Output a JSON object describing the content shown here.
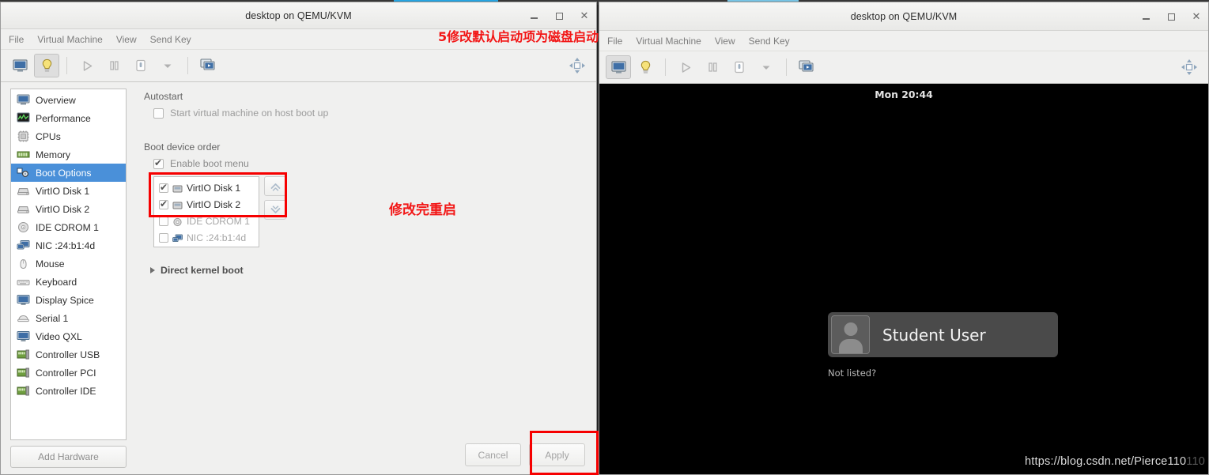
{
  "backdrop": {
    "desktop_bg": "#2b2b2b",
    "accent": "#29b0f0"
  },
  "annotations": {
    "top_note": "5修改默认启动项为磁盘启动",
    "middle_note": "修改完重启",
    "highlight_color": "#f60000"
  },
  "left_window": {
    "title": "desktop on QEMU/KVM",
    "window_buttons": {
      "minimize": "–",
      "maximize": "□",
      "close": "✕"
    },
    "menu": [
      "File",
      "Virtual Machine",
      "View",
      "Send Key"
    ],
    "toolbar": [
      {
        "name": "show-console-view",
        "icon": "monitor-icon",
        "pressed": false
      },
      {
        "name": "show-details-view",
        "icon": "lightbulb-icon",
        "pressed": true
      },
      {
        "name": "run-vm",
        "icon": "play-icon",
        "pressed": false
      },
      {
        "name": "pause-vm",
        "icon": "pause-icon",
        "pressed": false
      },
      {
        "name": "shutdown-vm",
        "icon": "power-icon",
        "pressed": false
      },
      {
        "name": "shutdown-options",
        "icon": "chevron-down-icon",
        "pressed": false
      },
      {
        "name": "snapshots",
        "icon": "snapshots-icon",
        "pressed": false
      },
      {
        "name": "fullscreen",
        "icon": "fullscreen-icon",
        "pressed": false
      }
    ],
    "hardware_list": [
      {
        "label": "Overview",
        "icon": "monitor-icon",
        "selected": false
      },
      {
        "label": "Performance",
        "icon": "graph-icon",
        "selected": false
      },
      {
        "label": "CPUs",
        "icon": "cpu-icon",
        "selected": false
      },
      {
        "label": "Memory",
        "icon": "memory-icon",
        "selected": false
      },
      {
        "label": "Boot Options",
        "icon": "boot-gear-icon",
        "selected": true
      },
      {
        "label": "VirtIO Disk 1",
        "icon": "disk-icon",
        "selected": false
      },
      {
        "label": "VirtIO Disk 2",
        "icon": "disk-icon",
        "selected": false
      },
      {
        "label": "IDE CDROM 1",
        "icon": "cdrom-icon",
        "selected": false
      },
      {
        "label": "NIC :24:b1:4d",
        "icon": "nic-icon",
        "selected": false
      },
      {
        "label": "Mouse",
        "icon": "mouse-icon",
        "selected": false
      },
      {
        "label": "Keyboard",
        "icon": "keyboard-icon",
        "selected": false
      },
      {
        "label": "Display Spice",
        "icon": "display-icon",
        "selected": false
      },
      {
        "label": "Serial 1",
        "icon": "serial-icon",
        "selected": false
      },
      {
        "label": "Video QXL",
        "icon": "video-icon",
        "selected": false
      },
      {
        "label": "Controller USB",
        "icon": "controller-icon",
        "selected": false
      },
      {
        "label": "Controller PCI",
        "icon": "controller-icon",
        "selected": false
      },
      {
        "label": "Controller IDE",
        "icon": "controller-icon",
        "selected": false
      }
    ],
    "add_hardware_label": "Add Hardware",
    "panel": {
      "autostart_title": "Autostart",
      "autostart_checkbox": {
        "label": "Start virtual machine on host boot up",
        "checked": false
      },
      "boot_order_title": "Boot device order",
      "boot_menu_checkbox": {
        "label": "Enable boot menu",
        "checked": true
      },
      "boot_devices": [
        {
          "label": "VirtIO Disk 1",
          "icon": "disk-icon",
          "checked": true
        },
        {
          "label": "VirtIO Disk 2",
          "icon": "disk-icon",
          "checked": true
        },
        {
          "label": "IDE CDROM 1",
          "icon": "cdrom-icon",
          "checked": false
        },
        {
          "label": "NIC :24:b1:4d",
          "icon": "nic-icon",
          "checked": false
        }
      ],
      "move_up_icon": "chevron-up-icon",
      "move_down_icon": "chevron-down-icon",
      "direct_kernel_boot": "Direct kernel boot"
    },
    "buttons": {
      "cancel": "Cancel",
      "apply": "Apply"
    }
  },
  "right_window": {
    "title": "desktop on QEMU/KVM",
    "window_buttons": {
      "minimize": "–",
      "maximize": "□",
      "close": "✕"
    },
    "menu": [
      "File",
      "Virtual Machine",
      "View",
      "Send Key"
    ],
    "toolbar": [
      {
        "name": "show-console-view",
        "icon": "monitor-icon",
        "pressed": true
      },
      {
        "name": "show-details-view",
        "icon": "lightbulb-icon",
        "pressed": false
      },
      {
        "name": "run-vm",
        "icon": "play-icon",
        "pressed": false
      },
      {
        "name": "pause-vm",
        "icon": "pause-icon",
        "pressed": false
      },
      {
        "name": "shutdown-vm",
        "icon": "power-icon",
        "pressed": false
      },
      {
        "name": "shutdown-options",
        "icon": "chevron-down-icon",
        "pressed": false
      },
      {
        "name": "snapshots",
        "icon": "snapshots-icon",
        "pressed": false
      },
      {
        "name": "fullscreen",
        "icon": "fullscreen-icon",
        "pressed": false
      }
    ],
    "guest": {
      "clock": "Mon 20:44",
      "user_name": "Student User",
      "not_listed": "Not listed?",
      "avatar_icon": "user-avatar-icon"
    },
    "watermark": {
      "text": "https://blog.csdn.net/Pierce110",
      "faded_tail": "110"
    }
  }
}
